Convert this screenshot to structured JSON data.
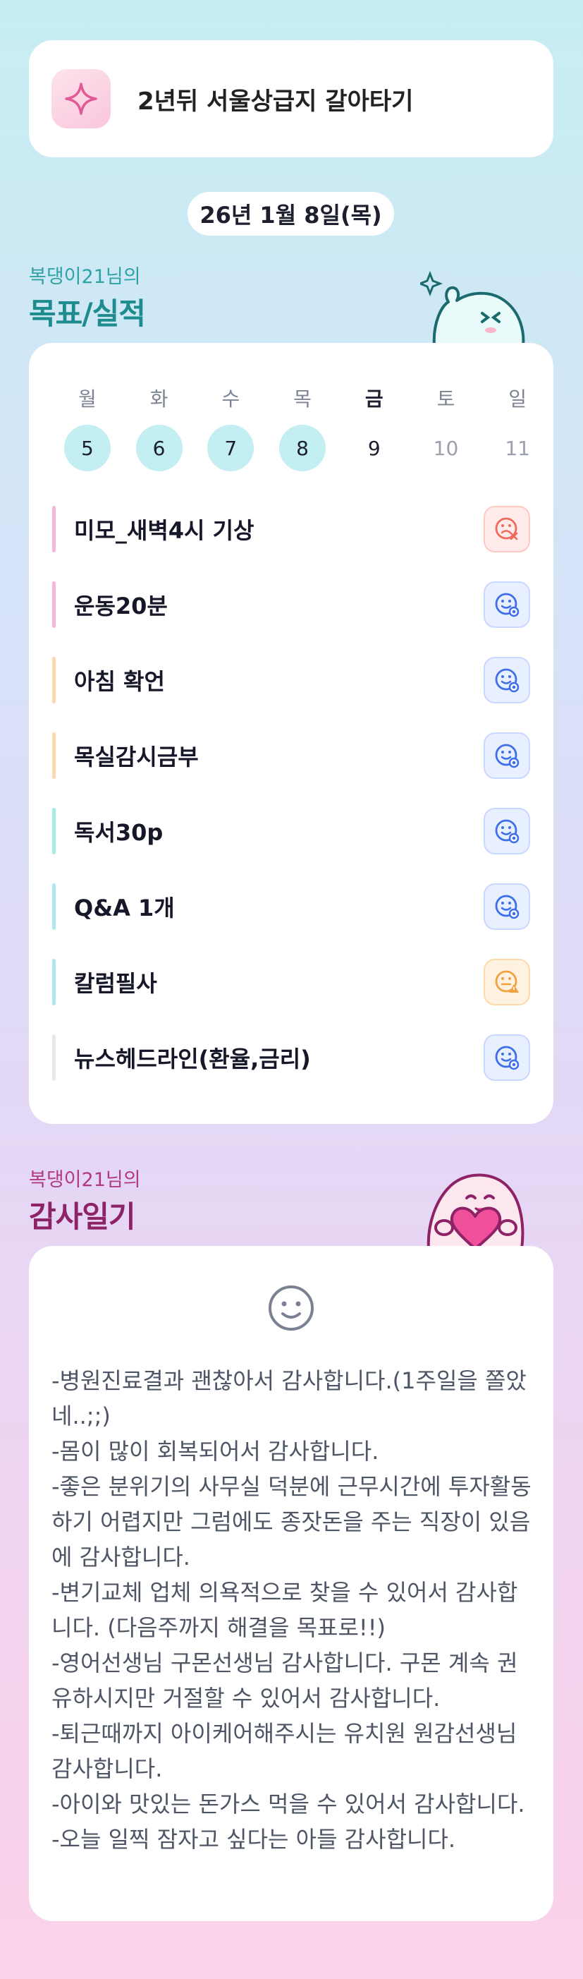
{
  "goal": {
    "title": "2년뒤 서울상급지 갈아타기"
  },
  "date_label": "26년 1월 8일(목)",
  "goals_section": {
    "who": "복댕이21님의",
    "title": "목표/실적"
  },
  "week": [
    {
      "name": "월",
      "num": "5",
      "state": "done"
    },
    {
      "name": "화",
      "num": "6",
      "state": "done"
    },
    {
      "name": "수",
      "num": "7",
      "state": "done"
    },
    {
      "name": "목",
      "num": "8",
      "state": "done"
    },
    {
      "name": "금",
      "num": "9",
      "state": "today"
    },
    {
      "name": "토",
      "num": "10",
      "state": "future"
    },
    {
      "name": "일",
      "num": "11",
      "state": "future"
    }
  ],
  "tasks": [
    {
      "label": "미모_새벽4시 기상",
      "status": "fail",
      "color": "#f6b8d6"
    },
    {
      "label": "운동20분",
      "status": "ok",
      "color": "#f6b8d6"
    },
    {
      "label": "아침 확언",
      "status": "ok",
      "color": "#fbd9ae"
    },
    {
      "label": "목실감시금부",
      "status": "ok",
      "color": "#fbd9ae"
    },
    {
      "label": "독서30p",
      "status": "ok",
      "color": "#a8ece0"
    },
    {
      "label": "Q&A 1개",
      "status": "ok",
      "color": "#aee7f1"
    },
    {
      "label": "칼럼필사",
      "status": "warn",
      "color": "#aee7f1"
    },
    {
      "label": "뉴스헤드라인(환율,금리)",
      "status": "ok",
      "color": "#e6e8ee"
    }
  ],
  "colors": {
    "ok": "#3f6fe8",
    "fail": "#ef6a5b",
    "warn": "#f3a03f"
  },
  "gratitude_section": {
    "who": "복댕이21님의",
    "title": "감사일기"
  },
  "gratitude": {
    "text": "-병원진료결과 괜찮아서 감사합니다.(1주일을 쫄았네..;;)\n-몸이 많이 회복되어서 감사합니다.\n-좋은 분위기의 사무실 덕분에 근무시간에 투자활동하기 어렵지만 그럼에도 종잣돈을 주는 직장이 있음에 감사합니다.\n-변기교체 업체 의욕적으로 찾을 수 있어서 감사합니다. (다음주까지 해결을 목표로!!)\n-영어선생님 구몬선생님 감사합니다. 구몬 계속 권유하시지만 거절할 수 있어서 감사합니다.\n-퇴근때까지 아이케어해주시는 유치원 원감선생님 감사합니다.\n-아이와 맛있는 돈가스 먹을 수 있어서 감사합니다.\n-오늘 일찍 잠자고 싶다는 아들 감사합니다."
  }
}
